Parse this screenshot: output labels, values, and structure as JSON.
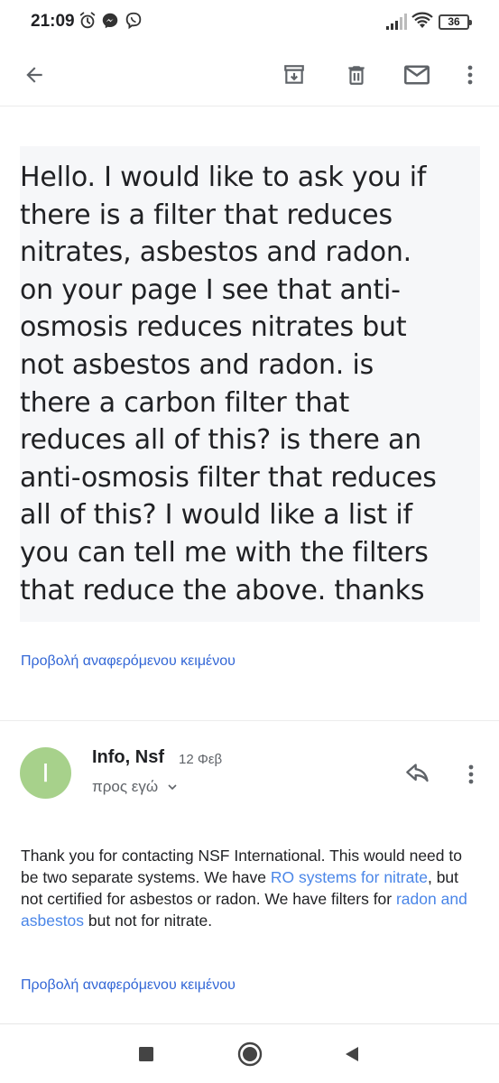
{
  "status_bar": {
    "time": "21:09",
    "battery": "36",
    "icons": [
      "alarm-icon",
      "messenger-icon",
      "viber-icon",
      "signal-icon",
      "wifi-icon",
      "battery-icon"
    ]
  },
  "toolbar": {
    "icons": [
      "back-arrow-icon",
      "archive-icon",
      "delete-icon",
      "mark-unread-icon",
      "more-vert-icon"
    ]
  },
  "quoted_message": {
    "lines": [
      "Hello. I would like to ask you if",
      "there is a filter that reduces",
      "nitrates, asbestos and radon.",
      "on your page I see that anti-",
      "osmosis reduces nitrates but",
      "not asbestos and radon. is",
      "there a carbon filter that",
      "reduces all of this? is there an",
      "anti-osmosis filter that reduces",
      "all of this? I would like a list if",
      "you can tell me with the filters",
      "that reduce the above. thanks"
    ],
    "show_quoted_label": "Προβολή αναφερόμενου κειμένου"
  },
  "reply_message": {
    "avatar_letter": "I",
    "sender": "Info, Nsf",
    "date": "12 Φεβ",
    "recipient": "προς εγώ",
    "body_part1": "Thank you for contacting NSF International. This would need to be two separate systems. We have ",
    "link1": "RO systems for nitrate",
    "body_part2": ", but not certified for asbestos or radon. We have filters for ",
    "link2": "radon and asbestos",
    "body_part3": " but not for nitrate.",
    "show_quoted_label": "Προβολή αναφερόμενου κειμένου"
  },
  "colors": {
    "accent": "#3367d6",
    "link": "#4a86e8",
    "avatar": "#a7d18b",
    "quoted_bg": "#f6f7f9"
  }
}
